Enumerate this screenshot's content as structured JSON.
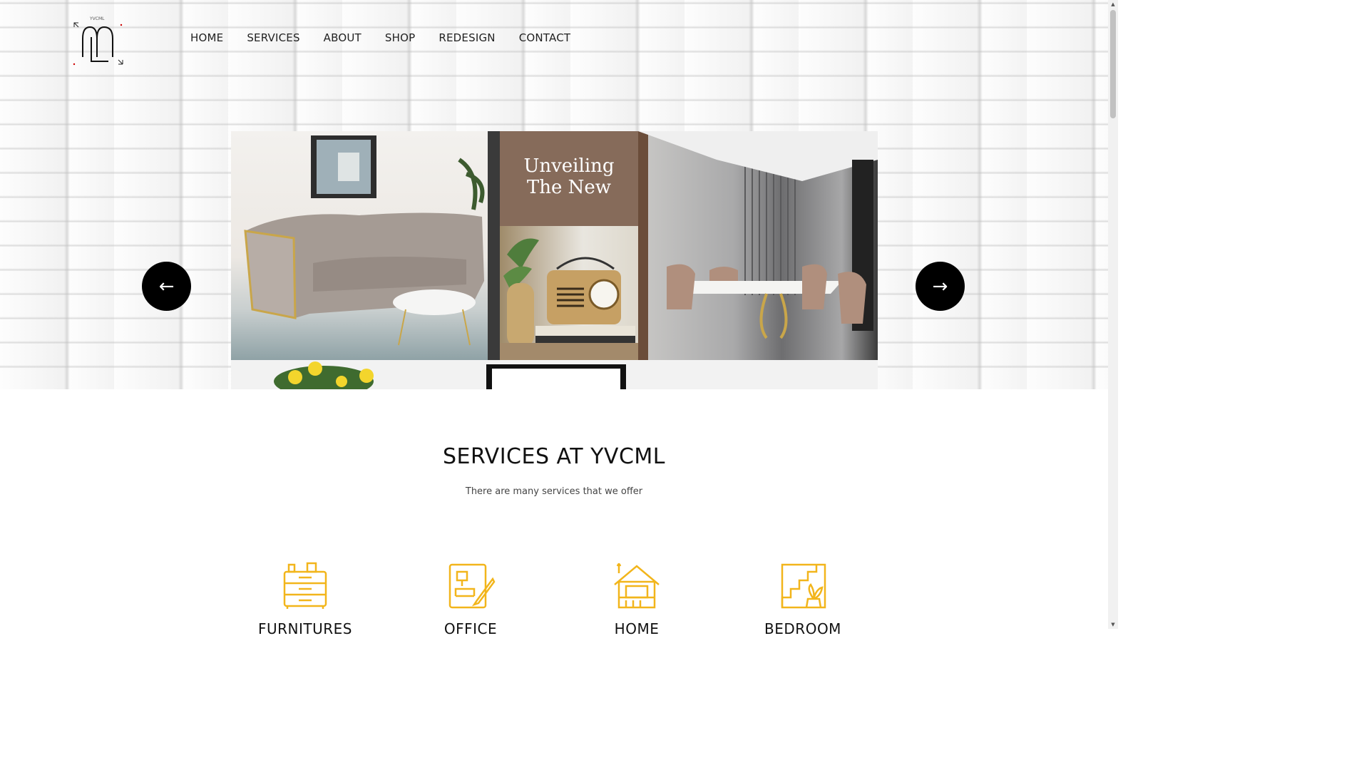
{
  "logo": {
    "text": "YVCML"
  },
  "nav": {
    "items": [
      "HOME",
      "SERVICES",
      "ABOUT",
      "SHOP",
      "REDESIGN",
      "CONTACT"
    ]
  },
  "hero": {
    "overlay_text_line1": "Unveiling",
    "overlay_text_line2": "The New",
    "prev_arrow": "←",
    "next_arrow": "→"
  },
  "services": {
    "title": "SERVICES AT YVCML",
    "subtitle": "There are many services that we offer",
    "items": [
      {
        "label": "FURNITURES",
        "icon": "cabinet-icon"
      },
      {
        "label": "OFFICE",
        "icon": "office-design-icon"
      },
      {
        "label": "HOME",
        "icon": "home-icon"
      },
      {
        "label": "BEDROOM",
        "icon": "stairs-plant-icon"
      }
    ],
    "icon_color": "#f2b51b"
  }
}
